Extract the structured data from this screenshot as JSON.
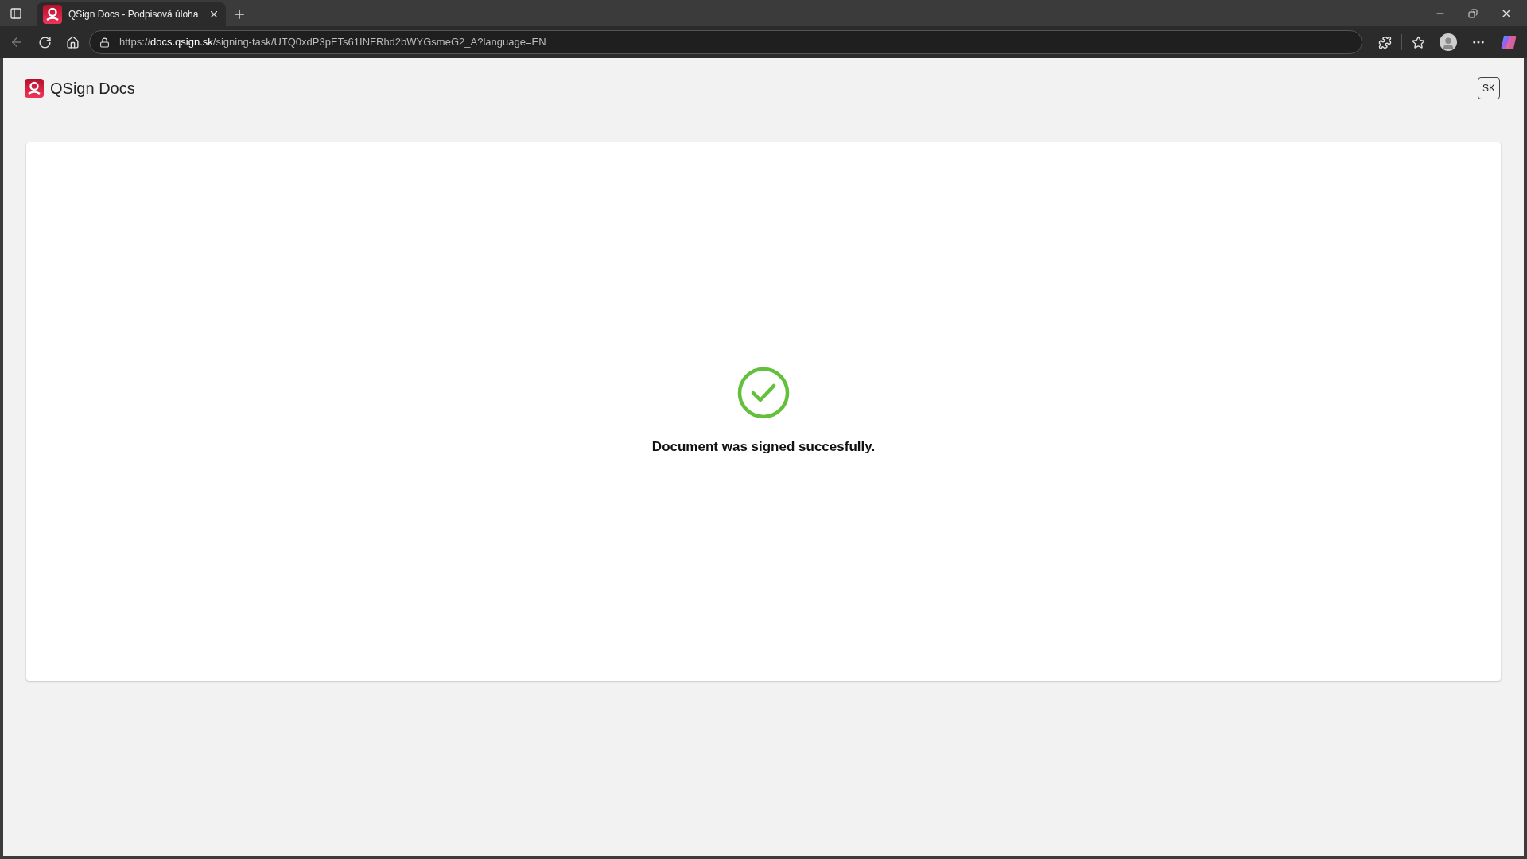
{
  "browser": {
    "tabs": [
      {
        "title": "QSign Docs - Podpisová úloha",
        "selected": true
      }
    ],
    "address": {
      "scheme": "https://",
      "host": "docs.qsign.sk",
      "path": "/signing-task/UTQ0xdP3pETs61INFRhd2bWYGsmeG2_A?language=EN"
    }
  },
  "header": {
    "app_name": "QSign Docs",
    "language_button": "SK"
  },
  "result": {
    "signed": true,
    "message": "Document was signed succesfully."
  }
}
